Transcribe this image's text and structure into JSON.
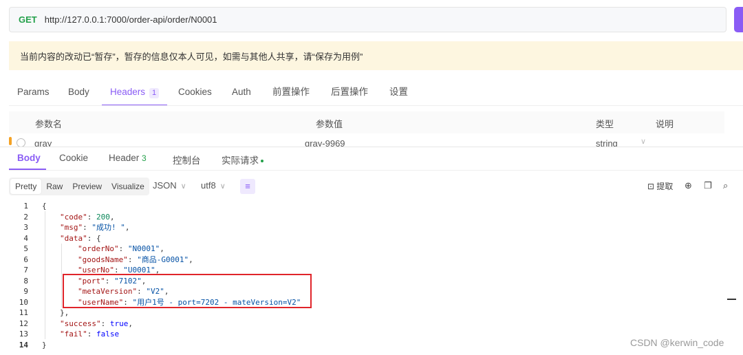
{
  "request": {
    "method": "GET",
    "url": "http://127.0.0.1:7000/order-api/order/N0001"
  },
  "notice": "当前内容的改动已“暂存”，暂存的信息仅本人可见，如需与其他人共享，请“保存为用例”",
  "request_tabs": [
    {
      "label": "Params"
    },
    {
      "label": "Body"
    },
    {
      "label": "Headers",
      "badge": "1",
      "active": true
    },
    {
      "label": "Cookies"
    },
    {
      "label": "Auth"
    },
    {
      "label": "前置操作"
    },
    {
      "label": "后置操作"
    },
    {
      "label": "设置"
    }
  ],
  "params_table": {
    "columns": [
      "参数名",
      "参数值",
      "类型",
      "说明"
    ],
    "row": {
      "name": "gray",
      "value": "gray-9969",
      "type": "string"
    }
  },
  "response_tabs": [
    {
      "label": "Body",
      "active": true
    },
    {
      "label": "Cookie"
    },
    {
      "label": "Header",
      "badge": "3"
    },
    {
      "label": "控制台"
    },
    {
      "label": "实际请求"
    }
  ],
  "toolbar": {
    "formats": [
      "Pretty",
      "Raw",
      "Preview",
      "Visualize"
    ],
    "active_format": "Pretty",
    "content_type": "JSON",
    "encoding": "utf8",
    "extract_label": "提取"
  },
  "code_lines": [
    {
      "no": "1",
      "text": "{"
    },
    {
      "no": "2",
      "key": "\"code\"",
      "val": "200",
      "vtype": "n",
      "tail": ","
    },
    {
      "no": "3",
      "key": "\"msg\"",
      "val": "\"成功! \"",
      "vtype": "s",
      "tail": ","
    },
    {
      "no": "4",
      "key": "\"data\"",
      "val": "{",
      "vtype": "p",
      "tail": ""
    },
    {
      "no": "5",
      "key": "\"orderNo\"",
      "val": "\"N0001\"",
      "vtype": "s",
      "tail": ","
    },
    {
      "no": "6",
      "key": "\"goodsName\"",
      "val": "\"商品-G0001\"",
      "vtype": "s",
      "tail": ","
    },
    {
      "no": "7",
      "key": "\"userNo\"",
      "val": "\"U0001\"",
      "vtype": "s",
      "tail": ","
    },
    {
      "no": "8",
      "key": "\"port\"",
      "val": "\"7102\"",
      "vtype": "s",
      "tail": ","
    },
    {
      "no": "9",
      "key": "\"metaVersion\"",
      "val": "\"V2\"",
      "vtype": "s",
      "tail": ","
    },
    {
      "no": "10",
      "key": "\"userName\"",
      "val": "\"用户1号 - port=7202 - mateVersion=V2\"",
      "vtype": "s",
      "tail": ""
    },
    {
      "no": "11",
      "text": "},"
    },
    {
      "no": "12",
      "key": "\"success\"",
      "val": "true",
      "vtype": "b",
      "tail": ","
    },
    {
      "no": "13",
      "key": "\"fail\"",
      "val": "false",
      "vtype": "b",
      "tail": ""
    },
    {
      "no": "14",
      "text": "}"
    }
  ],
  "watermark": "CSDN @kerwin_code",
  "colors": {
    "accent": "#8a5cf5",
    "method_green": "#23a04a",
    "highlight_red": "#e0242a",
    "notice_bg": "#fdf6e0"
  }
}
